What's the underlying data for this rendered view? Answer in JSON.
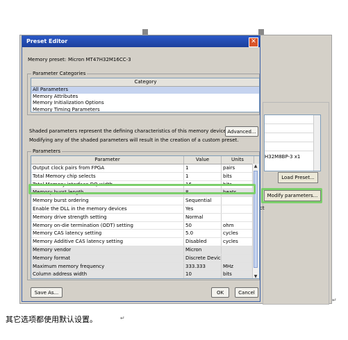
{
  "dialog": {
    "title": "Preset Editor",
    "memory_preset_label": "Memory preset:",
    "memory_preset_value": "Micron MT47H32M16CC-3",
    "categories_legend": "Parameter Categories",
    "category_header": "Category",
    "categories": [
      "All Parameters",
      "Memory Attributes",
      "Memory Initialization Options",
      "Memory Timing Parameters"
    ],
    "info_line1": "Shaded parameters represent the defining characteristics of this memory device.",
    "info_line2": "Modifying any of the shaded parameters will result in the creation of a custom preset.",
    "advanced_label": "Advanced...",
    "parameters_legend": "Parameters",
    "columns": [
      "Parameter",
      "Value",
      "Units"
    ],
    "rows": [
      {
        "p": "Output clock pairs from FPGA",
        "v": "1",
        "u": "pairs"
      },
      {
        "p": "Total Memory chip selects",
        "v": "1",
        "u": "bits"
      },
      {
        "p": "Total Memory interface DQ width",
        "v": "16",
        "u": "bits"
      },
      {
        "p": "Memory burst length",
        "v": "8",
        "u": "beats"
      },
      {
        "p": "Memory burst ordering",
        "v": "Sequential",
        "u": ""
      },
      {
        "p": "Enable the DLL in the memory devices",
        "v": "Yes",
        "u": ""
      },
      {
        "p": "Memory drive strength setting",
        "v": "Normal",
        "u": ""
      },
      {
        "p": "Memory on-die termination (ODT) setting",
        "v": "50",
        "u": "ohm"
      },
      {
        "p": "Memory CAS latency setting",
        "v": "5.0",
        "u": "cycles"
      },
      {
        "p": "Memory Additive CAS latency setting",
        "v": "Disabled",
        "u": "cycles"
      },
      {
        "p": "Memory vendor",
        "v": "Micron",
        "u": ""
      },
      {
        "p": "Memory format",
        "v": "Discrete Device",
        "u": ""
      },
      {
        "p": "Maximum memory frequency",
        "v": "333.333",
        "u": "MHz"
      },
      {
        "p": "Column address width",
        "v": "10",
        "u": "bits"
      }
    ],
    "save_as_label": "Save As...",
    "ok_label": "OK",
    "cancel_label": "Cancel"
  },
  "background": {
    "list_item": "H32M8BP-3 x1",
    "load_preset_label": "Load Preset...",
    "modify_parameters_label": "Modify parameters...",
    "partial_text": "ct"
  },
  "caption": "其它选项都使用默认设置。",
  "colors": {
    "title_bar": "#1c3f9c",
    "highlight_green": "#7ccf6b",
    "selected_category": "#c5d3ef"
  }
}
